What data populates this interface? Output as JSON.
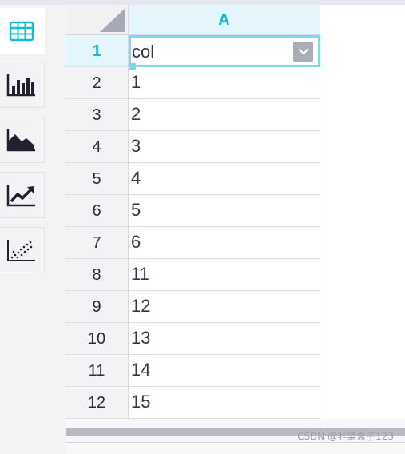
{
  "toolbar": {
    "items": [
      {
        "icon": "table-icon",
        "active": true
      },
      {
        "icon": "bar-chart-icon",
        "active": false
      },
      {
        "icon": "area-chart-icon",
        "active": false
      },
      {
        "icon": "line-chart-icon",
        "active": false
      },
      {
        "icon": "scatter-chart-icon",
        "active": false
      }
    ],
    "accent": "#1fb8d2"
  },
  "sheet": {
    "column_header": "A",
    "rows": [
      {
        "num": "1",
        "value": "col"
      },
      {
        "num": "2",
        "value": "1"
      },
      {
        "num": "3",
        "value": "2"
      },
      {
        "num": "4",
        "value": "3"
      },
      {
        "num": "5",
        "value": "4"
      },
      {
        "num": "6",
        "value": "5"
      },
      {
        "num": "7",
        "value": "6"
      },
      {
        "num": "8",
        "value": "11"
      },
      {
        "num": "9",
        "value": "12"
      },
      {
        "num": "10",
        "value": "13"
      },
      {
        "num": "11",
        "value": "14"
      },
      {
        "num": "12",
        "value": "15"
      }
    ],
    "selected_row": "1"
  },
  "watermark": "CSDN @韭菜盒子123"
}
